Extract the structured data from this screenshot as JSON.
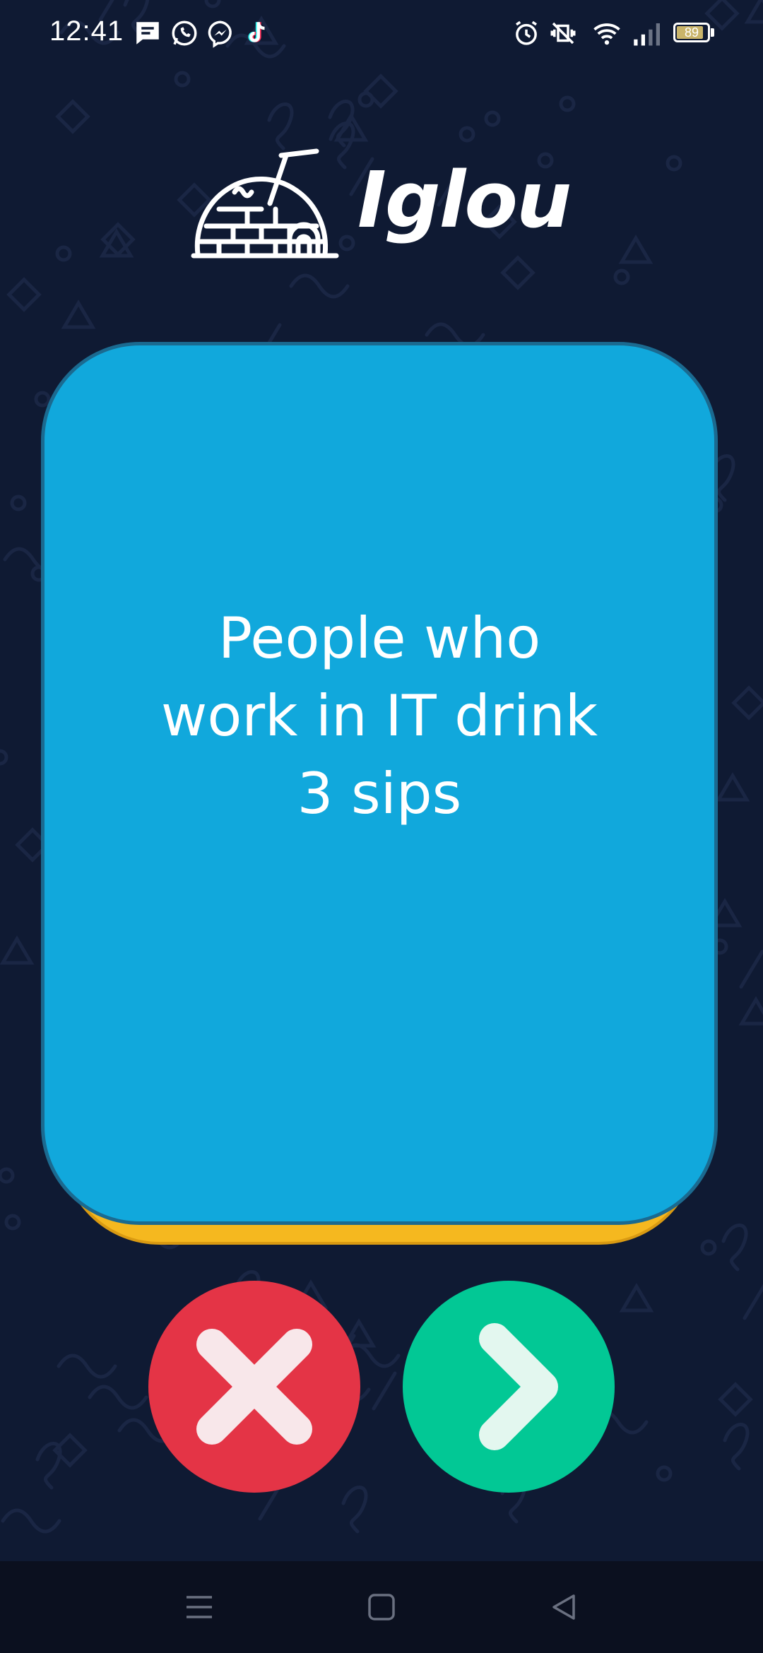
{
  "status_bar": {
    "time": "12:41",
    "battery_level": "89",
    "battery_fraction": 0.89,
    "notification_icons": [
      "message-icon",
      "whatsapp-icon",
      "messenger-icon",
      "tiktok-icon"
    ],
    "system_icons": [
      "alarm-icon",
      "vibrate-icon",
      "wifi-icon",
      "signal-icon",
      "battery-icon"
    ]
  },
  "app": {
    "name": "Iglou",
    "logo_icon": "igloo-icon"
  },
  "card": {
    "text": "People who work in IT drink 3 sips"
  },
  "actions": {
    "reject_icon": "close-icon",
    "next_icon": "chevron-right-icon"
  },
  "nav_bar": {
    "icons": [
      "menu-icon",
      "home-icon",
      "back-icon"
    ]
  },
  "colors": {
    "background": "#0f1a33",
    "card": "#11a8dc",
    "card_border": "#1b6a90",
    "card_stack": "#f5b81f",
    "reject": "#e43446",
    "next": "#02c895",
    "nav_bar": "#0b101f"
  }
}
